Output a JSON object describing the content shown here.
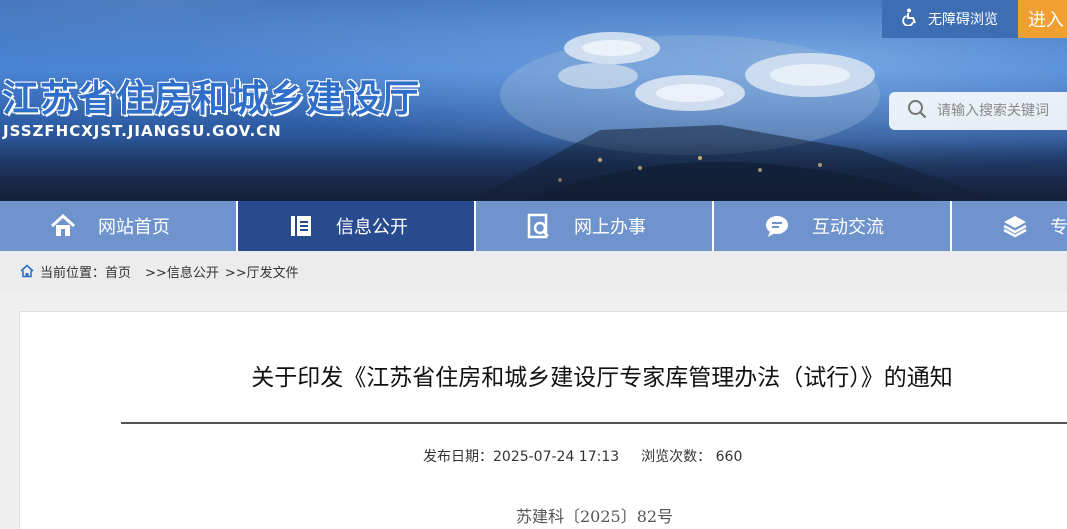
{
  "header": {
    "site_title": "江苏省住房和城乡建设厅",
    "site_domain": "JSSZFHCXJST.JIANGSU.GOV.CN",
    "accessibility_label": "无障碍浏览",
    "enter_label": "进入",
    "search_placeholder": "请输入搜索关键词",
    "colors": {
      "title": "#2f6fc9",
      "a11y_bg": "#3d6db3",
      "enter_bg": "#f0a030"
    }
  },
  "nav": {
    "items": [
      {
        "label": "网站首页",
        "icon": "home-icon"
      },
      {
        "label": "信息公开",
        "icon": "document-icon",
        "active": true
      },
      {
        "label": "网上办事",
        "icon": "service-search-icon"
      },
      {
        "label": "互动交流",
        "icon": "chat-icon"
      },
      {
        "label": "专",
        "icon": "layers-icon"
      }
    ],
    "colors": {
      "bg": "#6e93cd",
      "active_bg": "#284b90"
    }
  },
  "breadcrumb": {
    "prefix": "当前位置：",
    "items": [
      "首页",
      ">>信息公开",
      ">>厅发文件"
    ]
  },
  "article": {
    "title": "关于印发《江苏省住房和城乡建设厅专家库管理办法（试行）》的通知",
    "publish_label": "发布日期：",
    "publish_date": "2025-07-24 17:13",
    "views_label": "浏览次数：",
    "views_count": "660",
    "doc_number": "苏建科〔2025〕82号"
  }
}
